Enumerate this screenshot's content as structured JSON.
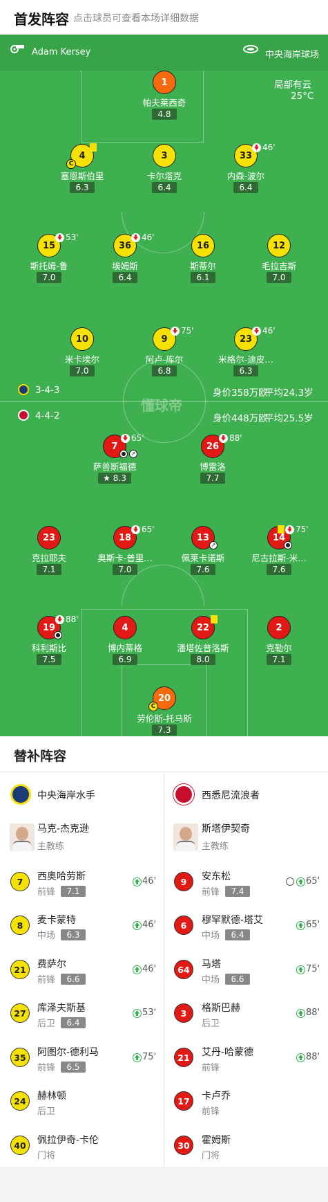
{
  "header": {
    "title": "首发阵容",
    "subtitle": "点击球员可查看本场详细数据"
  },
  "pitch": {
    "referee": "Adam Kersey",
    "stadium": "中央海岸球场",
    "weather": "局部有云",
    "temperature": "25°C",
    "watermark": "懂球帝",
    "home_info": {
      "formation": "3-4-3",
      "value": "身价358万欧",
      "age": "平均24.3岁"
    },
    "away_info": {
      "formation": "4-4-2",
      "value": "身价448万欧",
      "age": "平均25.5岁"
    }
  },
  "home_players": [
    {
      "number": "1",
      "name": "帕夫莱西奇",
      "rating": "4.8"
    },
    {
      "number": "4",
      "name": "塞恩斯伯里",
      "rating": "6.3"
    },
    {
      "number": "3",
      "name": "卡尔塔克",
      "rating": "6.4"
    },
    {
      "number": "33",
      "name": "内森-波尔",
      "rating": "6.4",
      "sub_min": "46'"
    },
    {
      "number": "15",
      "name": "斯托姆-鲁",
      "rating": "7.0",
      "sub_min": "53'"
    },
    {
      "number": "36",
      "name": "埃姆斯",
      "rating": "6.4",
      "sub_min": "46'"
    },
    {
      "number": "16",
      "name": "斯蒂尔",
      "rating": "6.1"
    },
    {
      "number": "12",
      "name": "毛拉吉斯",
      "rating": "7.0"
    },
    {
      "number": "10",
      "name": "米卡埃尔",
      "rating": "7.0"
    },
    {
      "number": "9",
      "name": "阿卢-库尔",
      "rating": "6.8",
      "sub_min": "75'"
    },
    {
      "number": "23",
      "name": "米格尔-迪皮…",
      "rating": "6.3",
      "sub_min": "46'"
    }
  ],
  "away_players": [
    {
      "number": "7",
      "name": "萨普斯福德",
      "rating": "8.3",
      "sub_min": "65'"
    },
    {
      "number": "26",
      "name": "博雷洛",
      "rating": "7.7",
      "sub_min": "88'"
    },
    {
      "number": "23",
      "name": "克拉耶夫",
      "rating": "7.1"
    },
    {
      "number": "18",
      "name": "奥斯卡-普里…",
      "rating": "7.0",
      "sub_min": "65'"
    },
    {
      "number": "13",
      "name": "佩莱卡诺斯",
      "rating": "7.6"
    },
    {
      "number": "14",
      "name": "尼古拉斯-米…",
      "rating": "7.6",
      "sub_min": "75'"
    },
    {
      "number": "19",
      "name": "科利斯比",
      "rating": "7.5",
      "sub_min": "88'"
    },
    {
      "number": "4",
      "name": "博内蒂格",
      "rating": "6.9"
    },
    {
      "number": "22",
      "name": "潘塔佐普洛斯",
      "rating": "8.0"
    },
    {
      "number": "2",
      "name": "克勒尔",
      "rating": "7.1"
    },
    {
      "number": "20",
      "name": "劳伦斯-托马斯",
      "rating": "7.3"
    }
  ],
  "subs": {
    "title": "替补阵容",
    "home": {
      "team": "中央海岸水手",
      "coach": {
        "name": "马克-杰克逊",
        "role": "主教练"
      },
      "players": [
        {
          "number": "7",
          "name": "西奥哈劳斯",
          "pos": "前锋",
          "rating": "7.1",
          "min": "46'"
        },
        {
          "number": "8",
          "name": "麦卡蒙特",
          "pos": "中场",
          "rating": "6.3",
          "min": "46'"
        },
        {
          "number": "21",
          "name": "费萨尔",
          "pos": "前锋",
          "rating": "6.6",
          "min": "46'"
        },
        {
          "number": "27",
          "name": "库泽夫斯基",
          "pos": "后卫",
          "rating": "6.4",
          "min": "53'"
        },
        {
          "number": "35",
          "name": "阿图尔-德利马",
          "pos": "前锋",
          "rating": "6.5",
          "min": "75'"
        },
        {
          "number": "24",
          "name": "赫林顿",
          "pos": "后卫"
        },
        {
          "number": "40",
          "name": "佩拉伊奇-卡伦",
          "pos": "门将"
        }
      ]
    },
    "away": {
      "team": "西悉尼流浪者",
      "coach": {
        "name": "斯塔伊契奇",
        "role": "主教练"
      },
      "players": [
        {
          "number": "9",
          "name": "安东松",
          "pos": "前锋",
          "rating": "7.4",
          "min": "65'"
        },
        {
          "number": "6",
          "name": "穆罕默德-塔艾",
          "pos": "中场",
          "rating": "6.4",
          "min": "65'"
        },
        {
          "number": "64",
          "name": "马塔",
          "pos": "中场",
          "rating": "6.6",
          "min": "75'"
        },
        {
          "number": "3",
          "name": "格斯巴赫",
          "pos": "后卫",
          "min": "88'"
        },
        {
          "number": "21",
          "name": "艾丹-哈蒙德",
          "pos": "前锋",
          "min": "88'"
        },
        {
          "number": "17",
          "name": "卡卢乔",
          "pos": "前锋"
        },
        {
          "number": "30",
          "name": "霍姆斯",
          "pos": "门将"
        }
      ]
    }
  },
  "colors": {
    "pitch": "#3eb04f",
    "home_shirt": "#f5e104",
    "away_shirt": "#e11a16",
    "keeper_shirt": "#f56a0c",
    "sub_up": "#2cae48"
  }
}
